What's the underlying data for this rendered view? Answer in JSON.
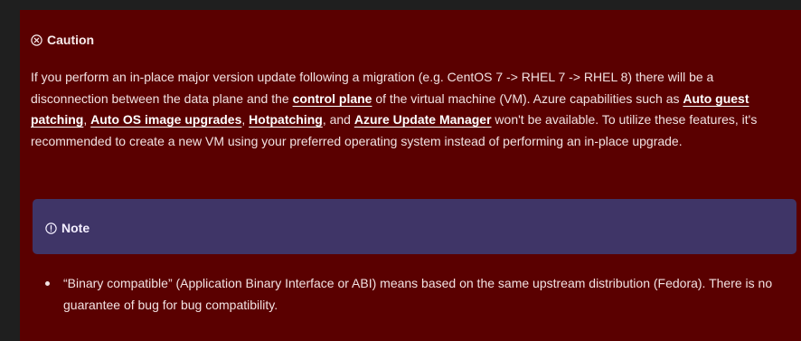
{
  "caution": {
    "icon": "circle-x-icon",
    "title": "Caution",
    "text_1": "If you perform an in-place major version update following a migration (e.g. CentOS 7 -> RHEL 7 -> RHEL 8) there will be a disconnection between the data plane and the ",
    "link_control_plane": "control plane",
    "text_2": " of the virtual machine (VM). Azure capabilities such as ",
    "link_auto_guest_patching": "Auto guest patching",
    "sep_1": ", ",
    "link_auto_os_image_upgrades": "Auto OS image upgrades",
    "sep_2": ", ",
    "link_hotpatching": "Hotpatching",
    "sep_3": ", and ",
    "link_azure_update_manager": "Azure Update Manager",
    "text_3": " won't be available. To utilize these features, it's recommended to create a new VM using your preferred operating system instead of performing an in-place upgrade."
  },
  "note": {
    "icon": "info-circle-icon",
    "title": "Note",
    "items": [
      "“Binary compatible” (Application Binary Interface or ABI) means based on the same upstream distribution (Fedora). There is no guarantee of bug for bug compatibility."
    ]
  },
  "colors": {
    "caution_background": "#5a0000",
    "note_background": "#3f3567",
    "page_background": "#1f1f1f",
    "text": "#f2e2e2"
  }
}
